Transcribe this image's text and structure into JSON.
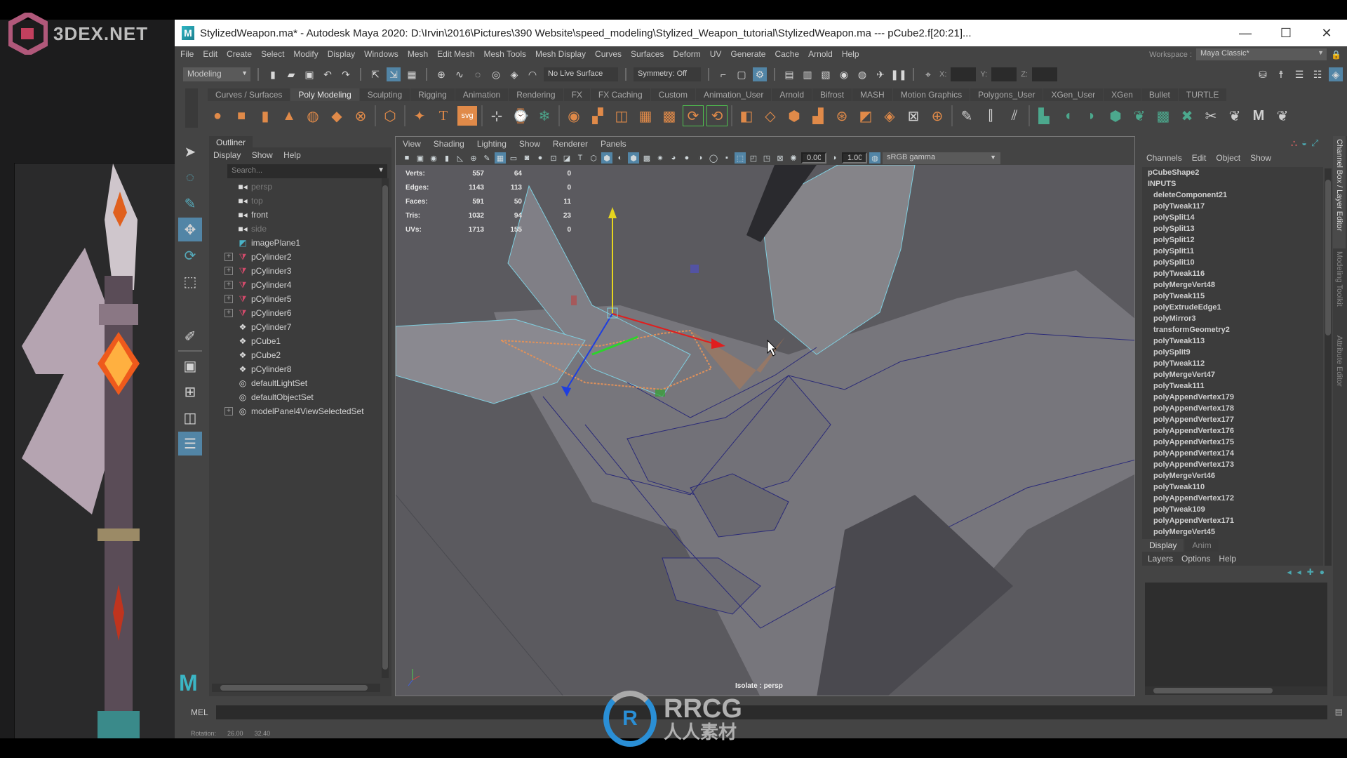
{
  "watermarks": {
    "top_left": "3DEX.NET",
    "center_title": "RRCG",
    "center_sub": "人人素材"
  },
  "window": {
    "title": "StylizedWeapon.ma* - Autodesk Maya 2020: D:\\Irvin\\2016\\Pictures\\390 Website\\speed_modeling\\Stylized_Weapon_tutorial\\StylizedWeapon.ma   ---   pCube2.f[20:21]...",
    "logo": "M",
    "minimize": "—",
    "maximize": "☐",
    "close": "✕"
  },
  "menubar": [
    "File",
    "Edit",
    "Create",
    "Select",
    "Modify",
    "Display",
    "Windows",
    "Mesh",
    "Edit Mesh",
    "Mesh Tools",
    "Mesh Display",
    "Curves",
    "Surfaces",
    "Deform",
    "UV",
    "Generate",
    "Cache",
    "Arnold",
    "Help"
  ],
  "workspace": {
    "label": "Workspace :",
    "value": "Maya Classic*"
  },
  "statusline": {
    "menuset": "Modeling",
    "live_surface": "No Live Surface",
    "symmetry": "Symmetry: Off",
    "x_label": "X:",
    "y_label": "Y:",
    "z_label": "Z:",
    "x_value": "",
    "y_value": "",
    "z_value": ""
  },
  "shelf": {
    "tabs": [
      "Curves / Surfaces",
      "Poly Modeling",
      "Sculpting",
      "Rigging",
      "Animation",
      "Rendering",
      "FX",
      "FX Caching",
      "Custom",
      "Animation_User",
      "Arnold",
      "Bifrost",
      "MASH",
      "Motion Graphics",
      "Polygons_User",
      "XGen_User",
      "XGen",
      "Bullet",
      "TURTLE"
    ],
    "active_tab": "Poly Modeling"
  },
  "outliner": {
    "tab": "Outliner",
    "menus": [
      "Display",
      "Show",
      "Help"
    ],
    "search_placeholder": "Search...",
    "items": [
      {
        "label": "persp",
        "icon": "camera-icon",
        "dim": true,
        "expandable": false
      },
      {
        "label": "top",
        "icon": "camera-icon",
        "dim": true,
        "expandable": false
      },
      {
        "label": "front",
        "icon": "camera-icon",
        "dim": false,
        "expandable": false
      },
      {
        "label": "side",
        "icon": "camera-icon",
        "dim": true,
        "expandable": false
      },
      {
        "label": "imagePlane1",
        "icon": "image-plane-icon",
        "dim": false,
        "expandable": false
      },
      {
        "label": "pCylinder2",
        "icon": "mesh-icon",
        "dim": false,
        "expandable": true
      },
      {
        "label": "pCylinder3",
        "icon": "mesh-icon",
        "dim": false,
        "expandable": true
      },
      {
        "label": "pCylinder4",
        "icon": "mesh-icon",
        "dim": false,
        "expandable": true
      },
      {
        "label": "pCylinder5",
        "icon": "mesh-icon",
        "dim": false,
        "expandable": true
      },
      {
        "label": "pCylinder6",
        "icon": "mesh-icon",
        "dim": false,
        "expandable": true
      },
      {
        "label": "pCylinder7",
        "icon": "transform-icon",
        "dim": false,
        "expandable": false
      },
      {
        "label": "pCube1",
        "icon": "transform-icon",
        "dim": false,
        "expandable": false
      },
      {
        "label": "pCube2",
        "icon": "transform-icon",
        "dim": false,
        "expandable": false
      },
      {
        "label": "pCylinder8",
        "icon": "transform-icon",
        "dim": false,
        "expandable": false
      },
      {
        "label": "defaultLightSet",
        "icon": "set-icon",
        "dim": false,
        "expandable": false
      },
      {
        "label": "defaultObjectSet",
        "icon": "set-icon",
        "dim": false,
        "expandable": false
      },
      {
        "label": "modelPanel4ViewSelectedSet",
        "icon": "set-icon",
        "dim": false,
        "expandable": true
      }
    ]
  },
  "viewport": {
    "menus": [
      "View",
      "Shading",
      "Lighting",
      "Show",
      "Renderer",
      "Panels"
    ],
    "exposure": "0.00",
    "gamma": "1.00",
    "color_space": "sRGB gamma",
    "isolate_label": "Isolate : persp",
    "hud": [
      {
        "label": "Verts:",
        "a": "557",
        "b": "64",
        "c": "0"
      },
      {
        "label": "Edges:",
        "a": "1143",
        "b": "113",
        "c": "0"
      },
      {
        "label": "Faces:",
        "a": "591",
        "b": "50",
        "c": "11"
      },
      {
        "label": "Tris:",
        "a": "1032",
        "b": "94",
        "c": "23"
      },
      {
        "label": "UVs:",
        "a": "1713",
        "b": "155",
        "c": "0"
      }
    ]
  },
  "channelbox": {
    "menus": [
      "Channels",
      "Edit",
      "Object",
      "Show"
    ],
    "shape": "pCubeShape2",
    "inputs_label": "INPUTS",
    "inputs": [
      "deleteComponent21",
      "polyTweak117",
      "polySplit14",
      "polySplit13",
      "polySplit12",
      "polySplit11",
      "polySplit10",
      "polyTweak116",
      "polyMergeVert48",
      "polyTweak115",
      "polyExtrudeEdge1",
      "polyMirror3",
      "transformGeometry2",
      "polyTweak113",
      "polySplit9",
      "polyTweak112",
      "polyMergeVert47",
      "polyTweak111",
      "polyAppendVertex179",
      "polyAppendVertex178",
      "polyAppendVertex177",
      "polyAppendVertex176",
      "polyAppendVertex175",
      "polyAppendVertex174",
      "polyAppendVertex173",
      "polyMergeVert46",
      "polyTweak110",
      "polyAppendVertex172",
      "polyTweak109",
      "polyAppendVertex171",
      "polyMergeVert45"
    ],
    "side_tabs": [
      "Channel Box / Layer Editor",
      "Modeling Toolkit",
      "Attribute Editor"
    ],
    "layer_tabs": [
      "Display",
      "Anim"
    ],
    "layer_menus": [
      "Layers",
      "Options",
      "Help"
    ]
  },
  "bottom": {
    "mel_label": "MEL",
    "mel_value": "",
    "help_label": "Rotation:",
    "help_values": [
      "26.00",
      "32.40"
    ]
  },
  "colors": {
    "accent": "#5285a6",
    "shelf_orange": "#e08a49",
    "shelf_green": "#4ca88d",
    "panel_bg": "#444444",
    "viewport_bg": "#5b5a5f"
  }
}
